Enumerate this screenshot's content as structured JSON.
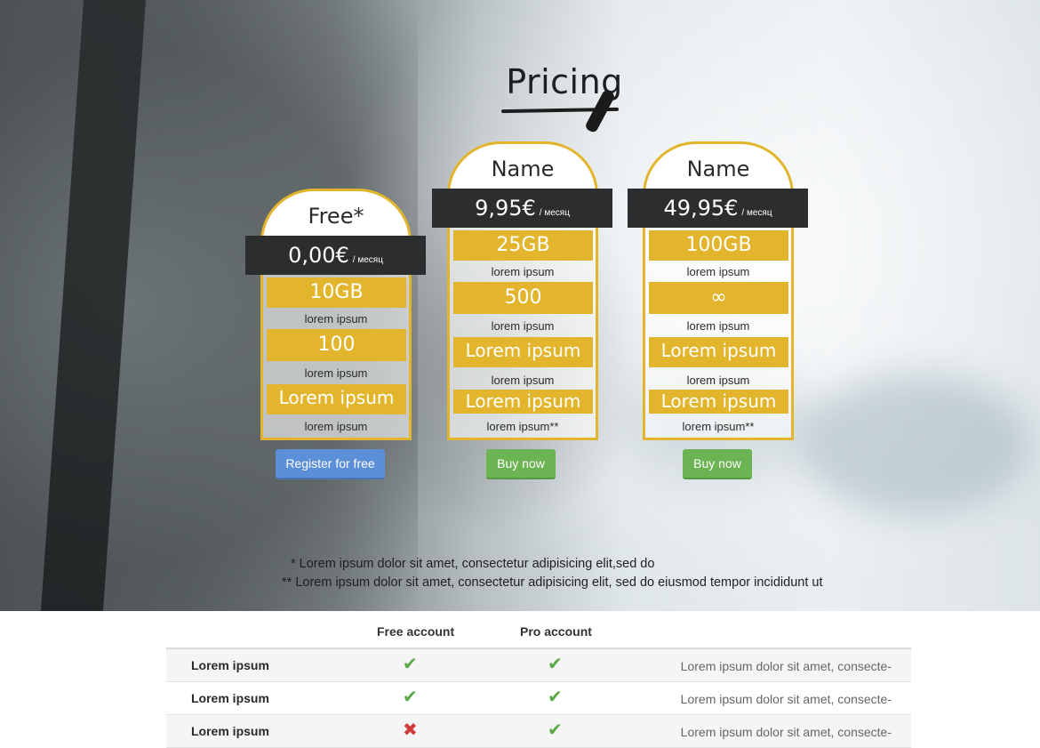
{
  "header": {
    "title": "Pricing"
  },
  "plans": [
    {
      "name": "Free*",
      "price": "0,00€",
      "period": "/ месяц",
      "features": [
        {
          "value": "10GB",
          "label": "lorem ipsum"
        },
        {
          "value": "100",
          "label": "lorem ipsum"
        },
        {
          "value": "Lorem ipsum",
          "label": "lorem ipsum"
        }
      ],
      "button": "Register for free"
    },
    {
      "name": "Name",
      "price": "9,95€",
      "period": "/ месяц",
      "features": [
        {
          "value": "25GB",
          "label": "lorem ipsum"
        },
        {
          "value": "500",
          "label": "lorem ipsum"
        },
        {
          "value": "Lorem ipsum",
          "label": "lorem ipsum"
        },
        {
          "value": "Lorem ipsum",
          "label": "lorem ipsum**"
        }
      ],
      "button": "Buy now"
    },
    {
      "name": "Name",
      "price": "49,95€",
      "period": "/ месяц",
      "features": [
        {
          "value": "100GB",
          "label": "lorem ipsum"
        },
        {
          "value": "∞",
          "label": "lorem ipsum"
        },
        {
          "value": "Lorem ipsum",
          "label": "lorem ipsum"
        },
        {
          "value": "Lorem ipsum",
          "label": "lorem ipsum**"
        }
      ],
      "button": "Buy now"
    }
  ],
  "footnotes": [
    "* Lorem ipsum dolor sit amet, consectetur adipisicing elit,sed do",
    "** Lorem ipsum dolor sit amet, consectetur adipisicing elit, sed do eiusmod tempor incididunt ut"
  ],
  "comparison": {
    "columns": [
      "Free account",
      "Pro account"
    ],
    "rows": [
      {
        "label": "Lorem ipsum",
        "free": "check",
        "pro": "check",
        "desc": "Lorem ipsum dolor sit amet, consecte-"
      },
      {
        "label": "Lorem ipsum",
        "free": "check",
        "pro": "check",
        "desc": "Lorem ipsum dolor sit amet, consecte-"
      },
      {
        "label": "Lorem ipsum",
        "free": "cross",
        "pro": "check",
        "desc": "Lorem ipsum dolor sit amet, consecte-"
      }
    ]
  },
  "colors": {
    "accent": "#e2b52d",
    "price_bar": "#2c2d2f",
    "register_button": "#5b8fd8",
    "buy_button": "#6cb453",
    "check": "#5aa846",
    "cross": "#d03b3b"
  },
  "icons": {
    "check": "check-icon",
    "cross": "cross-icon"
  }
}
